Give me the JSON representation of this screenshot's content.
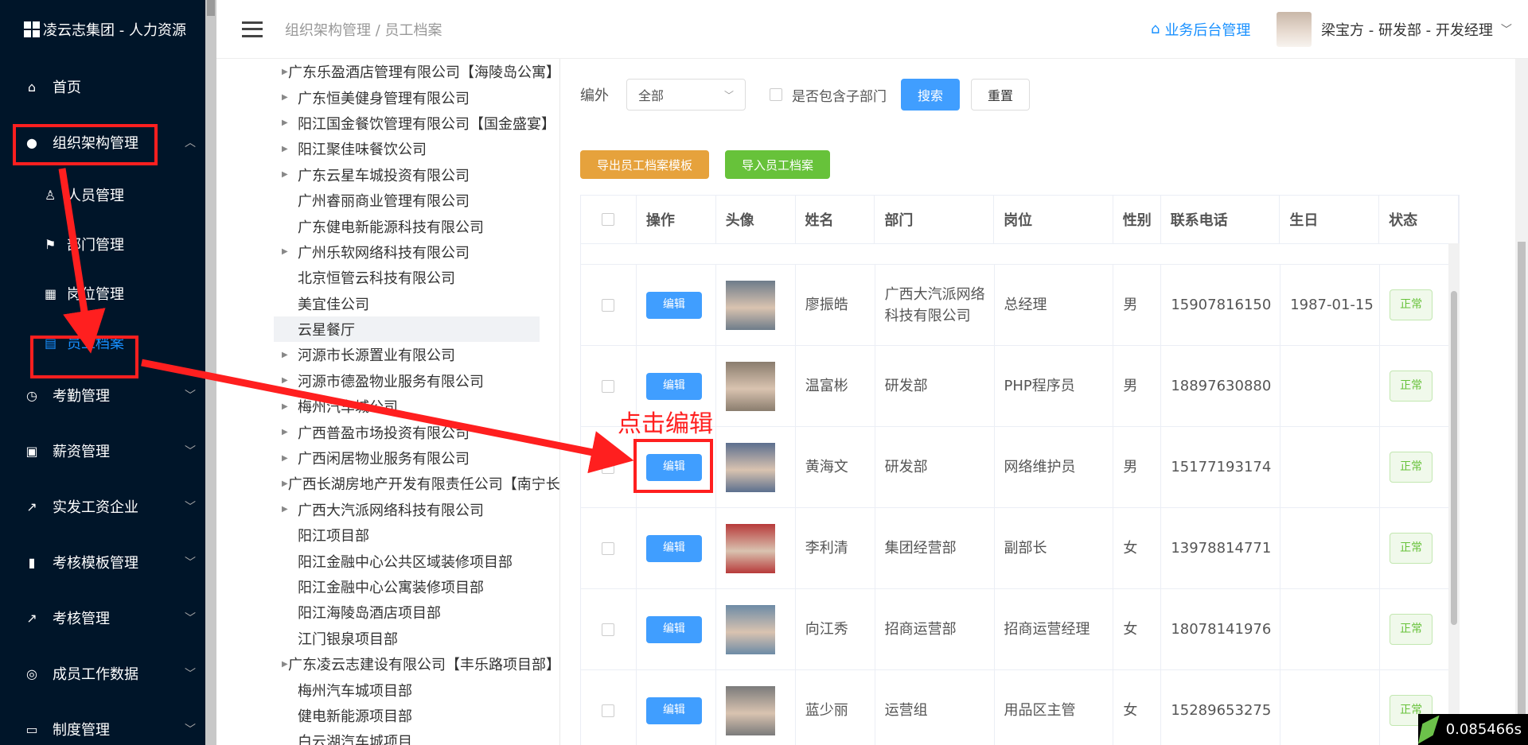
{
  "app": {
    "title": "凌云志集团 - 人力资源"
  },
  "sidebar": {
    "items": [
      {
        "label": "首页",
        "icon": "home-icon"
      },
      {
        "label": "组织架构管理",
        "icon": "user-icon"
      },
      {
        "label": "考勤管理",
        "icon": "clock-icon"
      },
      {
        "label": "薪资管理",
        "icon": "wallet-icon"
      },
      {
        "label": "实发工资企业",
        "icon": "chart-icon"
      },
      {
        "label": "考核模板管理",
        "icon": "book-icon"
      },
      {
        "label": "考核管理",
        "icon": "chart-icon"
      },
      {
        "label": "成员工作数据",
        "icon": "target-icon"
      },
      {
        "label": "制度管理",
        "icon": "doc-icon"
      }
    ],
    "sub_items": [
      {
        "label": "人员管理",
        "icon": "person-icon"
      },
      {
        "label": "部门管理",
        "icon": "flag-icon"
      },
      {
        "label": "岗位管理",
        "icon": "grid-icon"
      },
      {
        "label": "员工档案",
        "icon": "clipboard-icon"
      }
    ]
  },
  "header": {
    "breadcrumb": "组织架构管理 / 员工档案",
    "biz_link": "业务后台管理",
    "user": "梁宝方 - 研发部 - 开发经理"
  },
  "tree": [
    {
      "label": "广东乐盈酒店管理有限公司【海陵岛公寓】",
      "caret": true
    },
    {
      "label": "广东恒美健身管理有限公司",
      "caret": true
    },
    {
      "label": "阳江国金餐饮管理有限公司【国金盛宴】",
      "caret": true
    },
    {
      "label": "阳江聚佳味餐饮公司",
      "caret": true
    },
    {
      "label": "广东云星车城投资有限公司",
      "caret": true
    },
    {
      "label": "广州睿丽商业管理有限公司",
      "caret": false
    },
    {
      "label": "广东健电新能源科技有限公司",
      "caret": false
    },
    {
      "label": "广州乐软网络科技有限公司",
      "caret": true
    },
    {
      "label": "北京恒管云科技有限公司",
      "caret": false
    },
    {
      "label": "美宜佳公司",
      "caret": false
    },
    {
      "label": "云星餐厅",
      "caret": false
    },
    {
      "label": "河源市长源置业有限公司",
      "caret": true
    },
    {
      "label": "河源市德盈物业服务有限公司",
      "caret": true
    },
    {
      "label": "梅州汽车城公司",
      "caret": true
    },
    {
      "label": "广西普盈市场投资有限公司",
      "caret": true
    },
    {
      "label": "广西闲居物业服务有限公司",
      "caret": true
    },
    {
      "label": "广西长湖房地产开发有限责任公司【南宁长湖景】",
      "caret": true
    },
    {
      "label": "广西大汽派网络科技有限公司",
      "caret": true
    },
    {
      "label": "阳江项目部",
      "caret": false
    },
    {
      "label": "阳江金融中心公共区域装修项目部",
      "caret": false
    },
    {
      "label": "阳江金融中心公寓装修项目部",
      "caret": false
    },
    {
      "label": "阳江海陵岛酒店项目部",
      "caret": false
    },
    {
      "label": "江门银泉项目部",
      "caret": false
    },
    {
      "label": "广东凌云志建设有限公司【丰乐路项目部】",
      "caret": true
    },
    {
      "label": "梅州汽车城项目部",
      "caret": false
    },
    {
      "label": "健电新能源项目部",
      "caret": false
    },
    {
      "label": "白云湖汽车城项目",
      "caret": false
    }
  ],
  "filter": {
    "label": "编外",
    "select_value": "全部",
    "include_sub": "是否包含子部门",
    "search": "搜索",
    "reset": "重置",
    "export": "导出员工档案模板",
    "import": "导入员工档案"
  },
  "table": {
    "headers": [
      "操作",
      "头像",
      "姓名",
      "部门",
      "岗位",
      "性别",
      "联系电话",
      "生日",
      "状态"
    ],
    "edit_label": "编辑",
    "rows": [
      {
        "name": "廖振皓",
        "dept": "广西大汽派网络科技有限公司",
        "post": "总经理",
        "gender": "男",
        "phone": "15907816150",
        "birthday": "1987-01-15",
        "status": "正常"
      },
      {
        "name": "温富彬",
        "dept": "研发部",
        "post": "PHP程序员",
        "gender": "男",
        "phone": "18897630880",
        "birthday": "",
        "status": "正常"
      },
      {
        "name": "黄海文",
        "dept": "研发部",
        "post": "网络维护员",
        "gender": "男",
        "phone": "15177193174",
        "birthday": "",
        "status": "正常"
      },
      {
        "name": "李利清",
        "dept": "集团经营部",
        "post": "副部长",
        "gender": "女",
        "phone": "13978814771",
        "birthday": "",
        "status": "正常"
      },
      {
        "name": "向江秀",
        "dept": "招商运营部",
        "post": "招商运营经理",
        "gender": "女",
        "phone": "18078141976",
        "birthday": "",
        "status": "正常"
      },
      {
        "name": "蓝少丽",
        "dept": "运营组",
        "post": "用品区主管",
        "gender": "女",
        "phone": "15289653275",
        "birthday": "",
        "status": "正常"
      }
    ]
  },
  "annotation": "点击编辑",
  "timer": "0.085466s",
  "colors": {
    "sidebar_bg": "#001529",
    "accent": "#1890ff",
    "primary_btn": "#409eff",
    "annotation_red": "#ff1f1f"
  }
}
